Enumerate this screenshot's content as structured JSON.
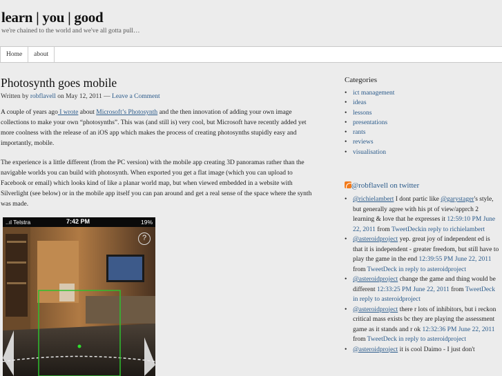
{
  "site": {
    "title": "learn | you | good",
    "tagline": "we're chained to the world and we've all gotta pull…"
  },
  "nav": {
    "home": "Home",
    "about": "about"
  },
  "post": {
    "title": "Photosynth goes mobile",
    "byline_prefix": "Written by ",
    "author": "robflavell",
    "byline_on": " on May 12, 2011 — ",
    "comment_link": "Leave a Comment",
    "p1_a": "A couple of years ago",
    "p1_link1": " I wrote",
    "p1_b": " about ",
    "p1_link2": "Microsoft’s Photosynth",
    "p1_c": " and the then innovation of adding your own image collections to make your own “photosynths”. This was (and still is) very cool, but Microsoft have recently added yet more coolness with the release of an iOS app which makes the process of creating photosynths stupidly easy and importantly, mobile.",
    "p2": "The experience is a little different (from the PC version) with the mobile app creating 3D panoramas rather than the navigable worlds you can build with photosynth. When exported you get a flat image (which you can upload to Facebook or email) which looks kind of like a planar world map, but when viewed embedded in a website with Silverlight (see below) or in the mobile app itself you can pan around and get a real sense of the space where the synth was made."
  },
  "phone": {
    "carrier": "..ıl Telstra",
    "time": "7:42 PM",
    "battery": "19%",
    "help": "?"
  },
  "sidebar": {
    "categories_heading": "Categories",
    "categories": [
      "ict management",
      "ideas",
      "lessons",
      "presentations",
      "rants",
      "reviews",
      "visualisation"
    ],
    "twitter_heading": "@robflavell on twitter",
    "tweets": [
      {
        "user": "@richielambert",
        "text": " I dont partic like ",
        "mention": "@garystager",
        "text2": "'s style, but generally agree with his pt of view/apprch 2 learning & love that he expresses it ",
        "time": "12:59:10 PM June 22, 2011",
        "from": " from ",
        "client": "TweetDeckin reply to richielambert"
      },
      {
        "user": "@asteroidproject",
        "text": " yep. great joy of independent ed is that it is independent - greater freedom, but still have to play the game in the end ",
        "time": "12:39:55 PM June 22, 2011",
        "from": " from ",
        "client": "TweetDeck in reply to asteroidproject"
      },
      {
        "user": "@asteroidproject",
        "text": " change the game and thing would be different ",
        "time": "12:33:25 PM June 22, 2011",
        "from": " from ",
        "client": "TweetDeck in reply to asteroidproject"
      },
      {
        "user": "@asteroidproject",
        "text": " there r lots of inhibitors, but i reckon critical mass exists bc they are playing the assessment game as it stands and r ok ",
        "time": "12:32:36 PM June 22, 2011",
        "from": " from ",
        "client": "TweetDeck in reply to asteroidproject"
      },
      {
        "user": "@asteroidproject",
        "text": " it is cool Daimo - I just don't"
      }
    ]
  }
}
